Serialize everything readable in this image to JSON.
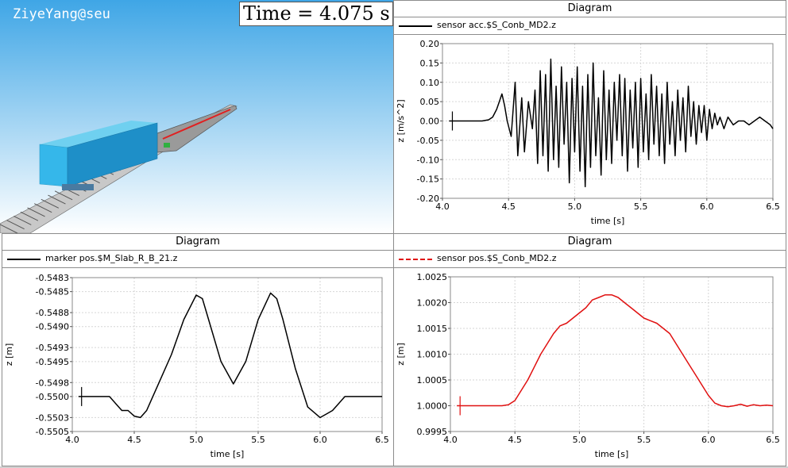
{
  "scene": {
    "watermark": "ZiyeYang@seu",
    "time_label": "Time = 4.075 s"
  },
  "chart_data": [
    {
      "id": "acc",
      "type": "line",
      "title": "Diagram",
      "legend": [
        {
          "name": "sensor acc.$S_Conb_MD2.z",
          "style": "solid",
          "color": "#000000"
        }
      ],
      "xlabel": "time [s]",
      "ylabel": "z [m/s^2]",
      "xlim": [
        4.0,
        6.5
      ],
      "ylim": [
        -0.2,
        0.2
      ],
      "xticks": [
        "4.0",
        "4.5",
        "5.0",
        "5.5",
        "6.0",
        "6.5"
      ],
      "yticks": [
        "0.20",
        "0.15",
        "0.10",
        "0.05",
        "0.00",
        "-0.05",
        "-0.10",
        "-0.15",
        "-0.20"
      ],
      "cursor_x": 4.075,
      "series": [
        {
          "name": "sensor acc.$S_Conb_MD2.z",
          "color": "#000000",
          "x": [
            4.05,
            4.2,
            4.3,
            4.35,
            4.38,
            4.41,
            4.43,
            4.45,
            4.47,
            4.49,
            4.52,
            4.55,
            4.57,
            4.6,
            4.62,
            4.65,
            4.68,
            4.7,
            4.72,
            4.74,
            4.76,
            4.78,
            4.8,
            4.82,
            4.84,
            4.86,
            4.88,
            4.9,
            4.92,
            4.94,
            4.96,
            4.98,
            5.0,
            5.02,
            5.04,
            5.06,
            5.08,
            5.1,
            5.12,
            5.14,
            5.16,
            5.18,
            5.2,
            5.22,
            5.24,
            5.26,
            5.28,
            5.3,
            5.32,
            5.34,
            5.36,
            5.38,
            5.4,
            5.42,
            5.44,
            5.46,
            5.48,
            5.5,
            5.52,
            5.54,
            5.56,
            5.58,
            5.6,
            5.62,
            5.64,
            5.66,
            5.68,
            5.7,
            5.72,
            5.74,
            5.76,
            5.78,
            5.8,
            5.82,
            5.84,
            5.86,
            5.88,
            5.9,
            5.92,
            5.94,
            5.96,
            5.98,
            6.0,
            6.02,
            6.04,
            6.06,
            6.08,
            6.1,
            6.13,
            6.16,
            6.2,
            6.24,
            6.28,
            6.32,
            6.36,
            6.4,
            6.44,
            6.48,
            6.5
          ],
          "y": [
            0.0,
            0.0,
            0.0,
            0.003,
            0.01,
            0.03,
            0.05,
            0.07,
            0.04,
            0.0,
            -0.04,
            0.1,
            -0.09,
            0.06,
            -0.08,
            0.05,
            -0.02,
            0.08,
            -0.11,
            0.13,
            -0.09,
            0.12,
            -0.13,
            0.16,
            -0.1,
            0.09,
            -0.12,
            0.14,
            -0.06,
            0.1,
            -0.16,
            0.11,
            -0.08,
            0.14,
            -0.13,
            0.09,
            -0.17,
            0.12,
            -0.12,
            0.15,
            -0.09,
            0.06,
            -0.14,
            0.13,
            -0.1,
            0.08,
            -0.11,
            0.1,
            -0.05,
            0.12,
            -0.09,
            0.11,
            -0.13,
            0.08,
            -0.07,
            0.1,
            -0.12,
            0.11,
            -0.08,
            0.07,
            -0.1,
            0.12,
            -0.06,
            0.09,
            -0.09,
            0.07,
            -0.11,
            0.1,
            -0.06,
            0.05,
            -0.09,
            0.08,
            -0.05,
            0.06,
            -0.08,
            0.09,
            -0.04,
            0.05,
            -0.06,
            0.04,
            -0.03,
            0.04,
            -0.05,
            0.03,
            -0.02,
            0.02,
            -0.01,
            0.01,
            -0.02,
            0.01,
            -0.01,
            0.0,
            0.0,
            -0.01,
            0.0,
            0.01,
            0.0,
            -0.01,
            -0.02
          ]
        }
      ]
    },
    {
      "id": "marker",
      "type": "line",
      "title": "Diagram",
      "legend": [
        {
          "name": "marker pos.$M_Slab_R_B_21.z",
          "style": "solid",
          "color": "#000000"
        }
      ],
      "xlabel": "time [s]",
      "ylabel": "z [m]",
      "xlim": [
        4.0,
        6.5
      ],
      "ylim": [
        -0.5505,
        -0.5483
      ],
      "xticks": [
        "4.0",
        "4.5",
        "5.0",
        "5.5",
        "6.0",
        "6.5"
      ],
      "yticks": [
        "-0.5483",
        "-0.5485",
        "-0.5488",
        "-0.5490",
        "-0.5493",
        "-0.5495",
        "-0.5498",
        "-0.5500",
        "-0.5503",
        "-0.5505"
      ],
      "cursor_x": 4.075,
      "series": [
        {
          "name": "marker pos.$M_Slab_R_B_21.z",
          "color": "#000000",
          "x": [
            4.05,
            4.3,
            4.35,
            4.4,
            4.45,
            4.5,
            4.55,
            4.6,
            4.7,
            4.8,
            4.9,
            5.0,
            5.05,
            5.1,
            5.2,
            5.3,
            5.4,
            5.5,
            5.6,
            5.65,
            5.7,
            5.8,
            5.9,
            6.0,
            6.05,
            6.1,
            6.15,
            6.2,
            6.3,
            6.4,
            6.5
          ],
          "y": [
            -0.55,
            -0.55,
            -0.5501,
            -0.5502,
            -0.5502,
            -0.55028,
            -0.5503,
            -0.5502,
            -0.5498,
            -0.5494,
            -0.5489,
            -0.54855,
            -0.5486,
            -0.5489,
            -0.5495,
            -0.54982,
            -0.5495,
            -0.5489,
            -0.54852,
            -0.5486,
            -0.5489,
            -0.5496,
            -0.55015,
            -0.5503,
            -0.55025,
            -0.5502,
            -0.5501,
            -0.55,
            -0.55,
            -0.55,
            -0.55
          ]
        }
      ]
    },
    {
      "id": "sensorpos",
      "type": "line",
      "title": "Diagram",
      "legend": [
        {
          "name": "sensor pos.$S_Conb_MD2.z",
          "style": "dashed",
          "color": "#e01010"
        }
      ],
      "xlabel": "time [s]",
      "ylabel": "z [m]",
      "xlim": [
        4.0,
        6.5
      ],
      "ylim": [
        0.9995,
        1.0025
      ],
      "xticks": [
        "4.0",
        "4.5",
        "5.0",
        "5.5",
        "6.0",
        "6.5"
      ],
      "yticks": [
        "1.0025",
        "1.0020",
        "1.0015",
        "1.0010",
        "1.0005",
        "1.0000",
        "0.9995"
      ],
      "cursor_x": 4.075,
      "series": [
        {
          "name": "sensor pos.$S_Conb_MD2.z",
          "color": "#e01010",
          "x": [
            4.05,
            4.4,
            4.45,
            4.5,
            4.55,
            4.6,
            4.65,
            4.7,
            4.75,
            4.8,
            4.85,
            4.9,
            4.95,
            5.0,
            5.05,
            5.1,
            5.15,
            5.2,
            5.25,
            5.3,
            5.35,
            5.4,
            5.45,
            5.5,
            5.55,
            5.6,
            5.65,
            5.7,
            5.75,
            5.8,
            5.85,
            5.9,
            5.95,
            6.0,
            6.05,
            6.1,
            6.15,
            6.2,
            6.25,
            6.3,
            6.35,
            6.4,
            6.45,
            6.5
          ],
          "y": [
            1.0,
            1.0,
            1.00002,
            1.0001,
            1.0003,
            1.0005,
            1.00075,
            1.001,
            1.0012,
            1.0014,
            1.00155,
            1.0016,
            1.0017,
            1.0018,
            1.0019,
            1.00205,
            1.0021,
            1.00215,
            1.00215,
            1.0021,
            1.002,
            1.0019,
            1.0018,
            1.0017,
            1.00165,
            1.0016,
            1.0015,
            1.0014,
            1.0012,
            1.001,
            1.0008,
            1.0006,
            1.0004,
            1.0002,
            1.00005,
            1.0,
            0.99998,
            1.0,
            1.00003,
            0.99999,
            1.00002,
            1.0,
            1.00001,
            1.0
          ]
        }
      ]
    }
  ]
}
